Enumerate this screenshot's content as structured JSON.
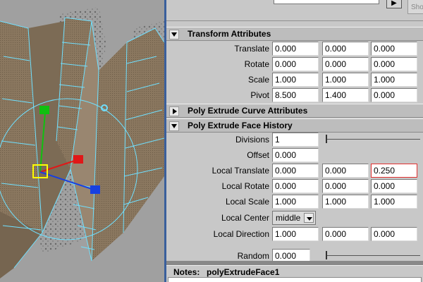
{
  "top": {
    "button_label": "Sho"
  },
  "sections": {
    "transform": {
      "title": "Transform Attributes",
      "expanded": true
    },
    "curve": {
      "title": "Poly Extrude Curve Attributes",
      "expanded": false
    },
    "face": {
      "title": "Poly Extrude Face History",
      "expanded": true
    }
  },
  "transform": {
    "translate": {
      "label": "Translate",
      "x": "0.000",
      "y": "0.000",
      "z": "0.000"
    },
    "rotate": {
      "label": "Rotate",
      "x": "0.000",
      "y": "0.000",
      "z": "0.000"
    },
    "scale": {
      "label": "Scale",
      "x": "1.000",
      "y": "1.000",
      "z": "1.000"
    },
    "pivot": {
      "label": "Pivot",
      "x": "8.500",
      "y": "1.400",
      "z": "0.000"
    }
  },
  "face": {
    "divisions": {
      "label": "Divisions",
      "value": "1"
    },
    "offset": {
      "label": "Offset",
      "value": "0.000"
    },
    "local_translate": {
      "label": "Local Translate",
      "x": "0.000",
      "y": "0.000",
      "z": "0.250"
    },
    "local_rotate": {
      "label": "Local Rotate",
      "x": "0.000",
      "y": "0.000",
      "z": "0.000"
    },
    "local_scale": {
      "label": "Local Scale",
      "x": "1.000",
      "y": "1.000",
      "z": "1.000"
    },
    "local_center": {
      "label": "Local Center",
      "value": "middle"
    },
    "local_direction": {
      "label": "Local Direction",
      "x": "1.000",
      "y": "0.000",
      "z": "0.000"
    },
    "random": {
      "label": "Random",
      "value": "0.000"
    }
  },
  "notes": {
    "label": "Notes:",
    "value": "polyExtrudeFace1"
  },
  "colors": {
    "viewport_bg": "#a0a0a0",
    "mesh_fill": "#8c7a63",
    "wire_highlight": "#6fe0ff",
    "manip_x": "#e01818",
    "manip_y": "#10c010",
    "manip_z": "#1840e0",
    "manip_center": "#ffff00",
    "active_field_border": "#e23030"
  }
}
